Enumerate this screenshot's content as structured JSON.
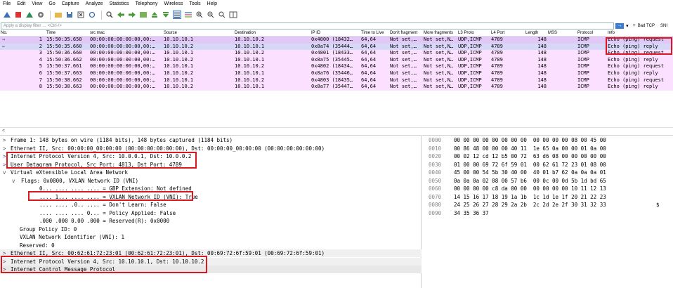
{
  "menu": [
    "File",
    "Edit",
    "View",
    "Go",
    "Capture",
    "Analyze",
    "Statistics",
    "Telephony",
    "Wireless",
    "Tools",
    "Help"
  ],
  "toolbar_icons": [
    "shark-fin-start-icon",
    "stop-icon",
    "restart-icon",
    "options-gear-icon",
    "open-folder-icon",
    "save-icon",
    "close-file-icon",
    "reload-icon",
    "find-icon",
    "back-arrow-icon",
    "forward-arrow-icon",
    "go-to-packet-icon",
    "first-packet-icon",
    "last-packet-icon",
    "autoscroll-icon",
    "colorize-icon",
    "zoom-in-icon",
    "zoom-out-icon",
    "normal-size-icon",
    "resize-columns-icon"
  ],
  "filter": {
    "placeholder": "Apply a display filter … <Ctrl-/>",
    "bad_tcp": "Bad TCP",
    "sni": "SNI"
  },
  "columns": [
    "No.",
    "Time",
    "src mac",
    "Source",
    "Destination",
    "IP ID",
    "Time to Live",
    "Don't fragment",
    "More fragments",
    "L3 Proto",
    "L4 Port",
    "Length",
    "MSS",
    "Protocol",
    "Info"
  ],
  "packets": [
    {
      "no": "1",
      "time": "15:50:35.658",
      "mac": "00:00:00:00:00:00,00:…",
      "src": "10.10.10.1",
      "dst": "10.10.10.2",
      "ipid": "0x4800 (18432…",
      "ttl": "64,64",
      "df": "Not set,…",
      "mf": "Not set,N…",
      "l3": "UDP,ICMP",
      "l4": "4789",
      "len": "148",
      "mss": "",
      "proto": "ICMP",
      "info": "Echo (ping) request"
    },
    {
      "no": "2",
      "time": "15:50:35.660",
      "mac": "00:00:00:00:00:00,00:…",
      "src": "10.10.10.2",
      "dst": "10.10.10.1",
      "ipid": "0x8a74 (35444…",
      "ttl": "64,64",
      "df": "Not set,…",
      "mf": "Not set,N…",
      "l3": "UDP,ICMP",
      "l4": "4789",
      "len": "148",
      "mss": "",
      "proto": "ICMP",
      "info": "Echo (ping) reply"
    },
    {
      "no": "3",
      "time": "15:50:36.660",
      "mac": "00:00:00:00:00:00,00:…",
      "src": "10.10.10.1",
      "dst": "10.10.10.2",
      "ipid": "0x4801 (18433…",
      "ttl": "64,64",
      "df": "Not set,…",
      "mf": "Not set,N…",
      "l3": "UDP,ICMP",
      "l4": "4789",
      "len": "148",
      "mss": "",
      "proto": "ICMP",
      "info": "Echo (ping) request"
    },
    {
      "no": "4",
      "time": "15:50:36.662",
      "mac": "00:00:00:00:00:00,00:…",
      "src": "10.10.10.2",
      "dst": "10.10.10.1",
      "ipid": "0x8a75 (35445…",
      "ttl": "64,64",
      "df": "Not set,…",
      "mf": "Not set,N…",
      "l3": "UDP,ICMP",
      "l4": "4789",
      "len": "148",
      "mss": "",
      "proto": "ICMP",
      "info": "Echo (ping) reply"
    },
    {
      "no": "5",
      "time": "15:50:37.661",
      "mac": "00:00:00:00:00:00,00:…",
      "src": "10.10.10.1",
      "dst": "10.10.10.2",
      "ipid": "0x4802 (18434…",
      "ttl": "64,64",
      "df": "Not set,…",
      "mf": "Not set,N…",
      "l3": "UDP,ICMP",
      "l4": "4789",
      "len": "148",
      "mss": "",
      "proto": "ICMP",
      "info": "Echo (ping) request"
    },
    {
      "no": "6",
      "time": "15:50:37.663",
      "mac": "00:00:00:00:00:00,00:…",
      "src": "10.10.10.2",
      "dst": "10.10.10.1",
      "ipid": "0x8a76 (35446…",
      "ttl": "64,64",
      "df": "Not set,…",
      "mf": "Not set,N…",
      "l3": "UDP,ICMP",
      "l4": "4789",
      "len": "148",
      "mss": "",
      "proto": "ICMP",
      "info": "Echo (ping) reply"
    },
    {
      "no": "7",
      "time": "15:50:38.662",
      "mac": "00:00:00:00:00:00,00:…",
      "src": "10.10.10.1",
      "dst": "10.10.10.2",
      "ipid": "0x4803 (18435…",
      "ttl": "64,64",
      "df": "Not set,…",
      "mf": "Not set,N…",
      "l3": "UDP,ICMP",
      "l4": "4789",
      "len": "148",
      "mss": "",
      "proto": "ICMP",
      "info": "Echo (ping) request"
    },
    {
      "no": "8",
      "time": "15:50:38.663",
      "mac": "00:00:00:00:00:00,00:…",
      "src": "10.10.10.2",
      "dst": "10.10.10.1",
      "ipid": "0x8a77 (35447…",
      "ttl": "64,64",
      "df": "Not set,…",
      "mf": "Not set,N…",
      "l3": "UDP,ICMP",
      "l4": "4789",
      "len": "148",
      "mss": "",
      "proto": "ICMP",
      "info": "Echo (ping) reply"
    }
  ],
  "details": [
    {
      "caret": ">",
      "text": "Frame 1: 148 bytes on wire (1184 bits), 148 bytes captured (1184 bits)",
      "level": 0
    },
    {
      "caret": ">",
      "text": "Ethernet II, Src: 00:00:00_00:00:00 (00:00:00:00:00:00), Dst: 00:00:00_00:00:00 (00:00:00:00:00:00)",
      "level": 0
    },
    {
      "caret": ">",
      "text": "Internet Protocol Version 4, Src: 10.0.0.1, Dst: 10.0.0.2",
      "level": 0
    },
    {
      "caret": ">",
      "text": "User Datagram Protocol, Src Port: 4813, Dst Port: 4789",
      "level": 0
    },
    {
      "caret": "v",
      "text": "Virtual eXtensible Local Area Network",
      "level": 0
    },
    {
      "caret": "v",
      "text": "Flags: 0x0800, VXLAN Network ID (VNI)",
      "level": 1
    },
    {
      "caret": "",
      "text": "0... .... .... .... = GBP Extension: Not defined",
      "level": 2
    },
    {
      "caret": "",
      "text": ".... 1... .... .... = VXLAN Network ID (VNI): True",
      "level": 2
    },
    {
      "caret": "",
      "text": ".... .... .0.. .... = Don't Learn: False",
      "level": 2
    },
    {
      "caret": "",
      "text": ".... .... .... 0... = Policy Applied: False",
      "level": 2
    },
    {
      "caret": "",
      "text": ".000 .000 0.00 .000 = Reserved(R): 0x0000",
      "level": 2
    },
    {
      "caret": "",
      "text": "Group Policy ID: 0",
      "level": 1
    },
    {
      "caret": "",
      "text": "VXLAN Network Identifier (VNI): 1",
      "level": 1
    },
    {
      "caret": "",
      "text": "Reserved: 0",
      "level": 1
    },
    {
      "caret": ">",
      "text": "Ethernet II, Src: 00:62:61:72:23:01 (00:62:61:72:23:01), Dst: 00:69:72:6f:59:01 (00:69:72:6f:59:01)",
      "level": 0
    },
    {
      "caret": ">",
      "text": "Internet Protocol Version 4, Src: 10.10.10.1, Dst: 10.10.10.2",
      "level": 0
    },
    {
      "caret": ">",
      "text": "Internet Control Message Protocol",
      "level": 0
    }
  ],
  "hex": [
    {
      "off": "0000",
      "bytes": "00 00 00 00 00 00 00 00  00 00 00 00 08 00 45 00",
      "ascii": ""
    },
    {
      "off": "0010",
      "bytes": "00 86 48 00 00 00 40 11  1e 65 0a 00 00 01 0a 00",
      "ascii": ""
    },
    {
      "off": "0020",
      "bytes": "00 02 12 cd 12 b5 00 72  63 d6 08 00 00 00 00 00",
      "ascii": ""
    },
    {
      "off": "0030",
      "bytes": "01 00 00 69 72 6f 59 01  00 62 61 72 23 01 08 00",
      "ascii": ""
    },
    {
      "off": "0040",
      "bytes": "45 00 00 54 5b 30 40 00  40 01 b7 62 0a 0a 0a 01",
      "ascii": ""
    },
    {
      "off": "0050",
      "bytes": "0a 0a 0a 02 08 00 57 b6  00 0c 00 0d 5b 1d bd 65",
      "ascii": ""
    },
    {
      "off": "0060",
      "bytes": "00 00 00 00 c8 da 00 00  00 00 00 00 10 11 12 13",
      "ascii": ""
    },
    {
      "off": "0070",
      "bytes": "14 15 16 17 18 19 1a 1b  1c 1d 1e 1f 20 21 22 23",
      "ascii": ""
    },
    {
      "off": "0080",
      "bytes": "24 25 26 27 28 29 2a 2b  2c 2d 2e 2f 30 31 32 33",
      "ascii": "$"
    },
    {
      "off": "0090",
      "bytes": "34 35 36 37",
      "ascii": ""
    }
  ],
  "colors": {
    "pink_row": "#fce0ff",
    "highlight_box": "#d9191f"
  }
}
